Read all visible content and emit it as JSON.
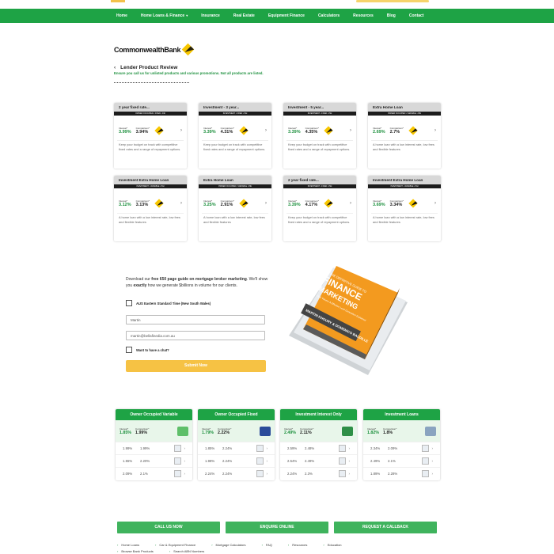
{
  "nav": {
    "items": [
      "Home",
      "Home Loans & Finance",
      "Insurance",
      "Real Estate",
      "Equipment Finance",
      "Calculators",
      "Resources",
      "Blog",
      "Contact"
    ]
  },
  "logo": {
    "word": "CommonwealthBank"
  },
  "review": {
    "title": "Lender Product Review",
    "subtitle": "Ensure you call us for unlisted products and various promotions. Not all products are listed."
  },
  "cards": [
    {
      "title": "2 year fixed rate...",
      "bar": "OWNER OCCUPIED • FIXED • P&I",
      "interest": "3.99%",
      "comparison": "3.94%",
      "desc": "Keep your budget on track with competitive fixed rates and a range of repayment options."
    },
    {
      "title": "Investment - 3 year...",
      "bar": "INVESTMENT • FIXED • P&I",
      "interest": "3.39%",
      "comparison": "4.31%",
      "desc": "Keep your budget on track with competitive fixed rates and a range of repayment options."
    },
    {
      "title": "Investment - 5 year...",
      "bar": "INVESTMENT • FIXED • P&I",
      "interest": "3.39%",
      "comparison": "4.35%",
      "desc": "Keep your budget on track with competitive fixed rates and a range of repayment options."
    },
    {
      "title": "Extra Home Loan",
      "bar": "OWNER OCCUPIED • VARIABLE • P&I",
      "interest": "2.69%",
      "comparison": "2.7%",
      "desc": "A home loan with a low interest rate, low fees and flexible features"
    },
    {
      "title": "Investment Extra Home Loan",
      "bar": "INVESTMENT • VARIABLE • P&I",
      "interest": "3.12%",
      "comparison": "3.13%",
      "desc": "A home loan with a low interest rate, low fees and flexible features"
    },
    {
      "title": "Extra Home Loan",
      "bar": "OWNER OCCUPIED • VARIABLE • P&I",
      "interest": "3.25%",
      "comparison": "2.91%",
      "desc": "A home loan with a low interest rate, low fees and flexible features"
    },
    {
      "title": "2 year fixed rate...",
      "bar": "INVESTMENT • FIXED • P&I",
      "interest": "3.39%",
      "comparison": "4.17%",
      "desc": "Keep your budget on track with competitive fixed rates and a range of repayment options."
    },
    {
      "title": "Investment Extra Home Loan",
      "bar": "INVESTMENT • VARIABLE • P&I",
      "interest": "3.69%",
      "comparison": "3.34%",
      "desc": "A home loan with a low interest rate, low fees and flexible features"
    }
  ],
  "labels": {
    "interest": "Interest*",
    "comparison": "Comparison*",
    "arrow": "›"
  },
  "download": {
    "pre": "Download our ",
    "bold1": "free 650 page guide on mortgage broker marketing",
    "mid": ". We'll show you ",
    "bold2": "exactly",
    "post": " how we generate $billions in volume for our clients.",
    "timezone": "AUS Eastern Standard Time (New South Wales)",
    "name_value": "Martin",
    "email_value": "martin@bellafinedia.com.au",
    "visit": "Want to have a chat?",
    "submit": "Submit Now"
  },
  "book": {
    "top": "THE DEFINITIVE GUIDE TO",
    "title1": "FINANCE",
    "title2": "MARKETING",
    "sub": "High Volume & Effective Lead Generation Explained",
    "authors": "MARTIN KHOURY & DOMENICO BALDILLE"
  },
  "rate_tables": [
    {
      "head": "Owner Occupied Variable",
      "interest": "1.85%",
      "comparison": "1.99%",
      "rows": [
        [
          "1.99%",
          "1.99%"
        ],
        [
          "1.55%",
          "2.20%"
        ],
        [
          "2.09%",
          "2.1%"
        ]
      ],
      "icon_color": "#5fbf6a"
    },
    {
      "head": "Owner Occupied Fixed",
      "interest": "1.79%",
      "comparison": "2.22%",
      "rows": [
        [
          "1.85%",
          "2.24%"
        ],
        [
          "1.98%",
          "2.24%"
        ],
        [
          "2.24%",
          "2.24%"
        ]
      ],
      "icon_color": "#2b4c9a"
    },
    {
      "head": "Investment Interest Only",
      "interest": "2.49%",
      "comparison": "2.11%",
      "rows": [
        [
          "2.59%",
          "2.48%"
        ],
        [
          "2.54%",
          "2.49%"
        ],
        [
          "2.24%",
          "2.3%"
        ]
      ],
      "icon_color": "#2f8f47"
    },
    {
      "head": "Investment Loans",
      "interest": "1.82%",
      "comparison": "1.8%",
      "rows": [
        [
          "2.34%",
          "2.09%"
        ],
        [
          "2.49%",
          "2.1%"
        ],
        [
          "1.89%",
          "2.28%"
        ]
      ],
      "icon_color": "#8aa4c0"
    }
  ],
  "cta": [
    "CALL US NOW",
    "ENQUIRE ONLINE",
    "REQUEST A CALLBACK"
  ],
  "footer": {
    "row1": [
      "Home Loans",
      "Car & Equipment Finance",
      "Mortgage Calculators",
      "FAQ",
      "Resources",
      "Education"
    ],
    "row2": [
      "Browse Bank Products",
      "Search ABN Numbers"
    ]
  }
}
